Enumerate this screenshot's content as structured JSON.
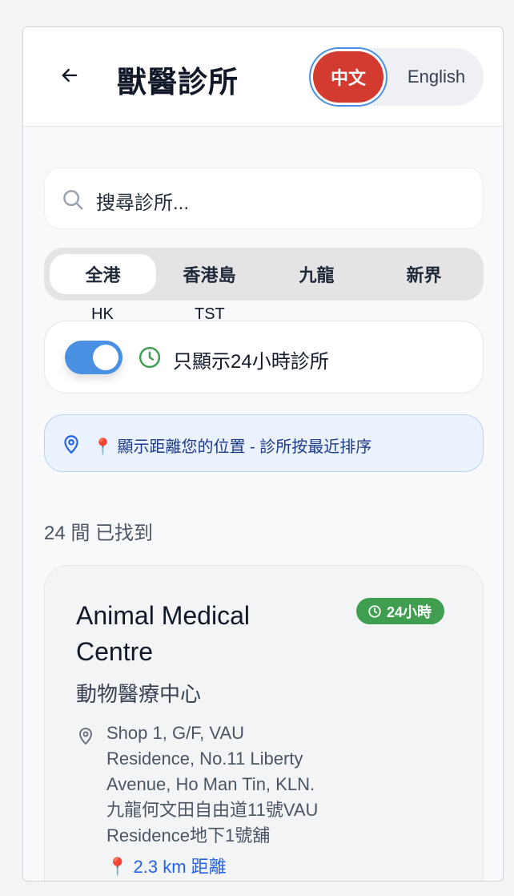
{
  "header": {
    "title": "獸醫診所",
    "languages": {
      "zh": "中文",
      "en": "English"
    }
  },
  "search": {
    "placeholder": "搜尋診所..."
  },
  "regions": {
    "tabs": [
      "全港",
      "香港島",
      "九龍",
      "新界"
    ],
    "active_index": 0,
    "sub_labels": [
      "HK",
      "TST"
    ]
  },
  "filter": {
    "toggle_label": "只顯示24小時診所",
    "toggle_on": true
  },
  "location_banner": {
    "text": "📍 顯示距離您的位置 - 診所按最近排序"
  },
  "results": {
    "count_text": "24 間 已找到"
  },
  "clinics": [
    {
      "name_en": "Animal Medical Centre",
      "name_zh": "動物醫療中心",
      "badge": "24小時",
      "address_lines": [
        "Shop 1, G/F, VAU",
        "Residence, No.11 Liberty",
        "Avenue, Ho Man Tin, KLN.",
        "九龍何文田自由道11號VAU",
        "Residence地下1號舖"
      ],
      "distance": "📍 2.3 km 距離"
    }
  ],
  "colors": {
    "accent_red": "#d33b30",
    "accent_blue": "#4a90e2",
    "badge_green": "#3f9e4f",
    "link_blue": "#2563eb"
  },
  "icons": [
    "arrow-left-icon",
    "search-icon",
    "clock-icon",
    "map-pin-icon"
  ]
}
